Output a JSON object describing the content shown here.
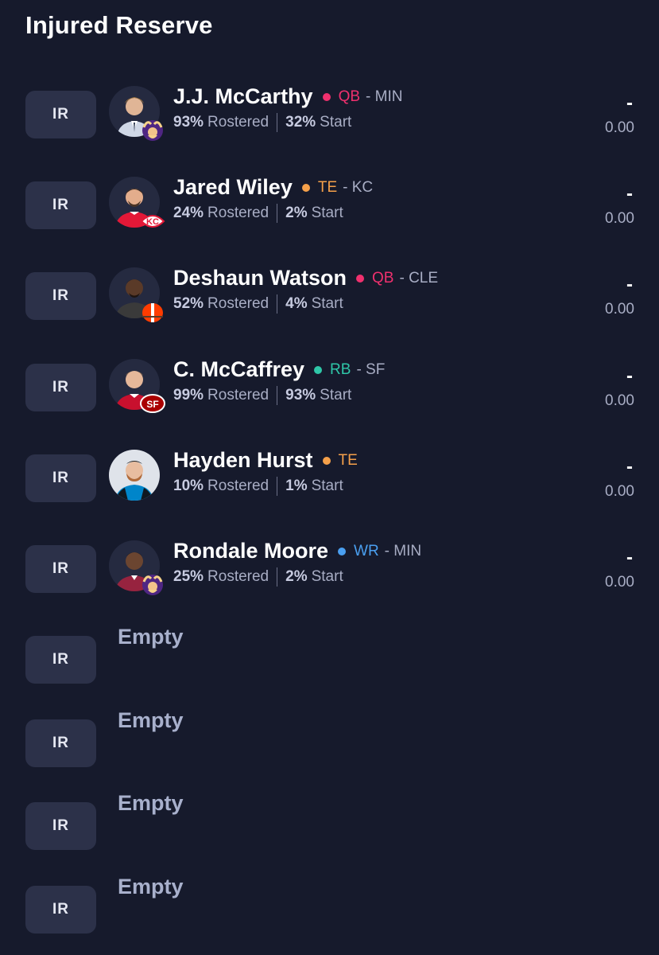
{
  "page": {
    "title": "Injured Reserve"
  },
  "colors": {
    "background": "#161a2c",
    "button": "#2c3149",
    "QB": "#f0306e",
    "TE": "#f5a04a",
    "RB": "#2fc7a8",
    "WR": "#4a9ff0"
  },
  "players": [
    {
      "slot_label": "IR",
      "name": "J.J. McCarthy",
      "position": "QB",
      "position_color": "#f0306e",
      "team_text": "- MIN",
      "team_logo": "vikings-logo",
      "rostered_pct": "93%",
      "rostered_label": "Rostered",
      "start_pct": "32%",
      "start_label": "Start",
      "score_dash": "-",
      "score": "0.00"
    },
    {
      "slot_label": "IR",
      "name": "Jared Wiley",
      "position": "TE",
      "position_color": "#f5a04a",
      "team_text": "- KC",
      "team_logo": "chiefs-logo",
      "rostered_pct": "24%",
      "rostered_label": "Rostered",
      "start_pct": "2%",
      "start_label": "Start",
      "score_dash": "-",
      "score": "0.00"
    },
    {
      "slot_label": "IR",
      "name": "Deshaun Watson",
      "position": "QB",
      "position_color": "#f0306e",
      "team_text": "- CLE",
      "team_logo": "browns-logo",
      "rostered_pct": "52%",
      "rostered_label": "Rostered",
      "start_pct": "4%",
      "start_label": "Start",
      "score_dash": "-",
      "score": "0.00"
    },
    {
      "slot_label": "IR",
      "name": "C. McCaffrey",
      "position": "RB",
      "position_color": "#2fc7a8",
      "team_text": "- SF",
      "team_logo": "49ers-logo",
      "rostered_pct": "99%",
      "rostered_label": "Rostered",
      "start_pct": "93%",
      "start_label": "Start",
      "score_dash": "-",
      "score": "0.00"
    },
    {
      "slot_label": "IR",
      "name": "Hayden Hurst",
      "position": "TE",
      "position_color": "#f5a04a",
      "team_text": "",
      "team_logo": "",
      "rostered_pct": "10%",
      "rostered_label": "Rostered",
      "start_pct": "1%",
      "start_label": "Start",
      "score_dash": "-",
      "score": "0.00"
    },
    {
      "slot_label": "IR",
      "name": "Rondale Moore",
      "position": "WR",
      "position_color": "#4a9ff0",
      "team_text": "- MIN",
      "team_logo": "vikings-logo",
      "rostered_pct": "25%",
      "rostered_label": "Rostered",
      "start_pct": "2%",
      "start_label": "Start",
      "score_dash": "-",
      "score": "0.00"
    }
  ],
  "empty_slots": [
    {
      "slot_label": "IR",
      "text": "Empty"
    },
    {
      "slot_label": "IR",
      "text": "Empty"
    },
    {
      "slot_label": "IR",
      "text": "Empty"
    },
    {
      "slot_label": "IR",
      "text": "Empty"
    }
  ]
}
